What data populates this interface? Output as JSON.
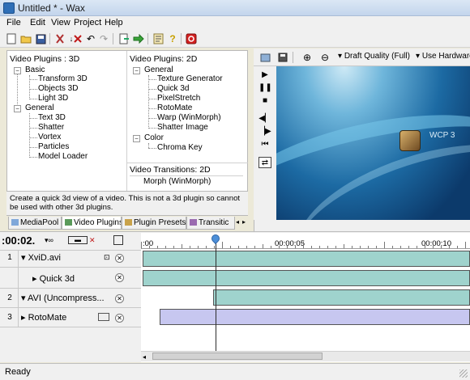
{
  "window": {
    "title": "Untitled * - Wax"
  },
  "menu": {
    "items": [
      "File",
      "Edit",
      "View",
      "Project",
      "Help"
    ]
  },
  "plugins": {
    "title_3d": "Video Plugins : 3D",
    "title_2d": "Video Plugins: 2D",
    "title_transitions": "Video Transitions: 2D",
    "tree_3d": {
      "basic_label": "Basic",
      "basic_items": [
        "Transform 3D",
        "Objects 3D",
        "Light 3D"
      ],
      "general_label": "General",
      "general_items": [
        "Text 3D",
        "Shatter",
        "Vortex",
        "Particles",
        "Model Loader"
      ]
    },
    "tree_2d": {
      "general_label": "General",
      "general_items": [
        "Texture Generator",
        "Quick 3d",
        "PixelStretch",
        "RotoMate",
        "Warp (WinMorph)",
        "Shatter Image"
      ],
      "color_label": "Color",
      "color_items": [
        "Chroma Key"
      ]
    },
    "transitions": [
      "Morph (WinMorph)"
    ],
    "description": "Create a quick 3d view of a video. This is not a 3d plugin so cannot be used with other 3d plugins."
  },
  "tabs": [
    "MediaPool",
    "Video Plugins",
    "Plugin Presets",
    "Transitic"
  ],
  "preview": {
    "quality": "Draft Quality (Full)",
    "hardware": "Use Hardware A",
    "video_label": "WCP 3"
  },
  "timeline": {
    "timecode": ":00:02.",
    "ruler_labels": ":00",
    "ruler_labels_list": [
      ":00",
      "00:00:05",
      "00:00:10"
    ],
    "tracks": [
      {
        "num": "1",
        "name": "XviD.avi"
      },
      {
        "num": "",
        "name": "Quick 3d"
      },
      {
        "num": "2",
        "name": "AVI (Uncompress..."
      },
      {
        "num": "3",
        "name": "RotoMate"
      }
    ]
  },
  "status": {
    "text": "Ready"
  },
  "colors": {
    "clip_green": "#9fd3cd",
    "clip_purple": "#c7c7f0",
    "accent": "#4d8fd8"
  }
}
